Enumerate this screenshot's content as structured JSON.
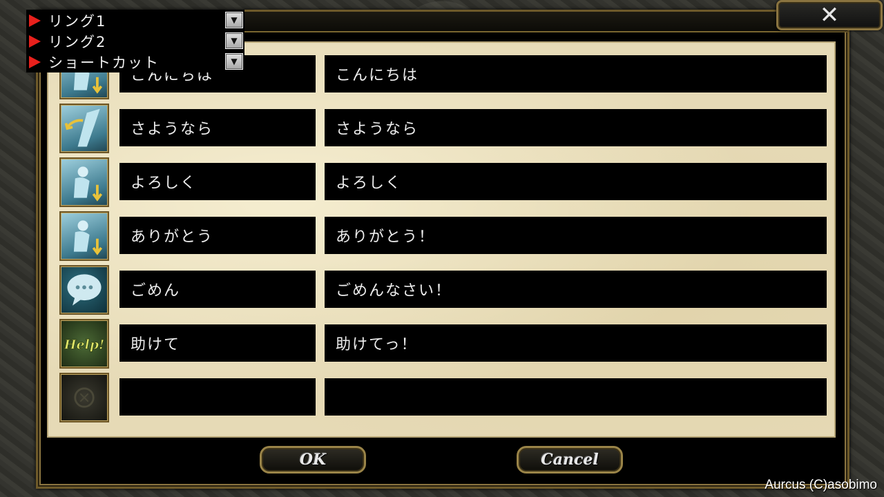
{
  "window": {
    "close_icon": "close-x-icon",
    "close_glyph": "✕"
  },
  "dropdowns": [
    {
      "label": "リング1",
      "toggle": "▼"
    },
    {
      "label": "リング2",
      "toggle": "▼"
    },
    {
      "label": "ショートカット",
      "toggle": "▼"
    }
  ],
  "rows": [
    {
      "icon": "pose-bow-icon",
      "short": "こんにちは",
      "full": "こんにちは"
    },
    {
      "icon": "pose-wave-icon",
      "short": "さようなら",
      "full": "さようなら"
    },
    {
      "icon": "pose-bow-icon",
      "short": "よろしく",
      "full": "よろしく"
    },
    {
      "icon": "pose-bow-icon",
      "short": "ありがとう",
      "full": "ありがとう！"
    },
    {
      "icon": "speech-bubble-icon",
      "short": "ごめん",
      "full": "ごめんなさい！"
    },
    {
      "icon": "help-icon",
      "short": "助けて",
      "full": "助けてっ！",
      "icon_text": "Help!"
    },
    {
      "icon": "empty-slot-icon",
      "short": "",
      "full": ""
    }
  ],
  "buttons": {
    "ok": "OK",
    "cancel": "Cancel"
  },
  "copyright": "Aurcus (C)asobimo",
  "colors": {
    "arrow": "#e8201c",
    "parchment": "#e6dab6",
    "frame": "#8a7440"
  }
}
